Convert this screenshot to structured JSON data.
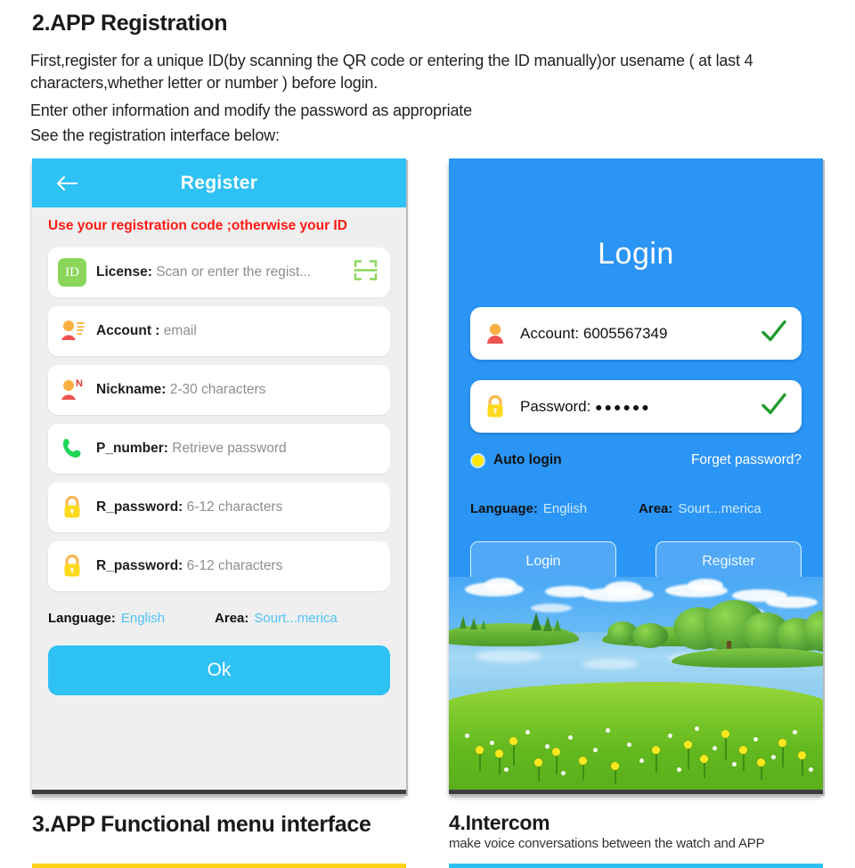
{
  "document": {
    "heading": "2.APP Registration",
    "paragraph_1": "First,register for a unique ID(by scanning the QR code or entering the ID manually)or usename ( at last 4 characters,whether letter or number ) before login.",
    "paragraph_2": "Enter other information and modify the password as appropriate",
    "paragraph_3": "See the registration interface below:",
    "caption_3": "3.APP Functional menu interface",
    "caption_4": "4.Intercom",
    "caption_4_sub": "make voice conversations between the watch and APP"
  },
  "register_screen": {
    "back_icon": "back-arrow-icon",
    "title": "Register",
    "note": "Use your registration code ;otherwise your ID",
    "fields": [
      {
        "icon": "id-badge-icon",
        "icon_text": "ID",
        "label": "License:",
        "placeholder": "Scan or enter the regist...",
        "trailing_icon": "qr-scan-icon"
      },
      {
        "icon": "account-list-icon",
        "label": "Account :",
        "placeholder": "email",
        "trailing_icon": ""
      },
      {
        "icon": "nickname-icon",
        "icon_text": "N",
        "label": "Nickname:",
        "placeholder": "2-30 characters",
        "trailing_icon": ""
      },
      {
        "icon": "phone-icon",
        "label": "P_number:",
        "placeholder": "Retrieve password",
        "trailing_icon": ""
      },
      {
        "icon": "lock-icon",
        "label": "R_password:",
        "placeholder": "6-12 characters",
        "trailing_icon": ""
      },
      {
        "icon": "lock-icon",
        "label": "R_password:",
        "placeholder": "6-12 characters",
        "trailing_icon": ""
      }
    ],
    "language_label": "Language:",
    "language_value": "English",
    "area_label": "Area:",
    "area_value": "Sourt...merica",
    "ok_label": "Ok"
  },
  "login_screen": {
    "title": "Login",
    "account_label": "Account:",
    "account_value": "6005567349",
    "account_icon": "person-icon",
    "account_check": "check-icon",
    "password_label": "Password:",
    "password_value": "●●●●●●",
    "password_icon": "lock-icon",
    "password_check": "check-icon",
    "auto_login_label": "Auto login",
    "auto_login_radio": "radio-selected-icon",
    "forget_password_label": "Forget password?",
    "language_label": "Language:",
    "language_value": "English",
    "area_label": "Area:",
    "area_value": "Sourt...merica",
    "login_button": "Login",
    "register_button": "Register"
  },
  "colors": {
    "register_header": "#2ec1f3",
    "login_background": "#2b95f5",
    "note_red": "#ff1a13",
    "link_blue": "#4fc3f7",
    "accent_yellow": "#fcd116",
    "accent_cyan": "#2ec1f3",
    "id_badge_green": "#8bd65a",
    "check_green": "#1f9c2f"
  }
}
